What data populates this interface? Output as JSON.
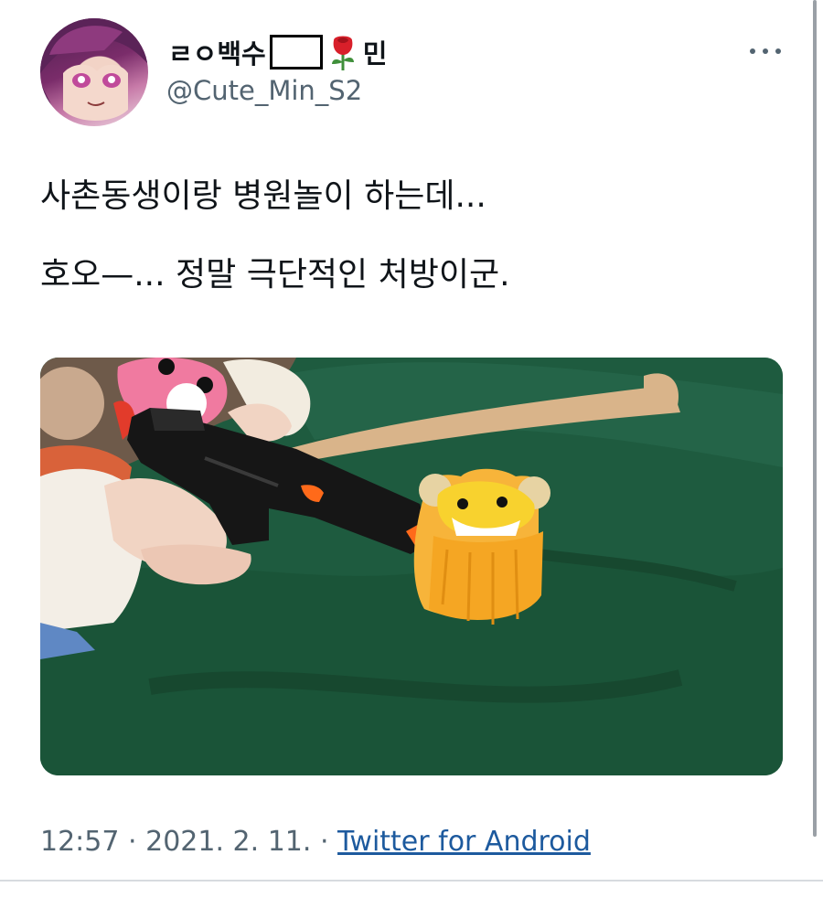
{
  "tweet": {
    "display_name_prefix": "ㄹㅇ백수",
    "display_name_suffix": "민",
    "handle": "@Cute_Min_S2",
    "text_lines": [
      "사촌동생이랑 병원놀이 하는데...",
      "호오—... 정말 극단적인 처방이군."
    ],
    "time": "12:57",
    "date": "2021. 2. 11.",
    "separator": "·",
    "source": "Twitter for Android"
  },
  "icons": {
    "avatar": "anime-character-avatar",
    "name_emoji": "rose-icon",
    "menu": "more-options-icon"
  },
  "colors": {
    "text": "#0f1419",
    "secondary_text": "#536471",
    "link": "#1d5a9e",
    "divider": "#d7dbdf"
  }
}
